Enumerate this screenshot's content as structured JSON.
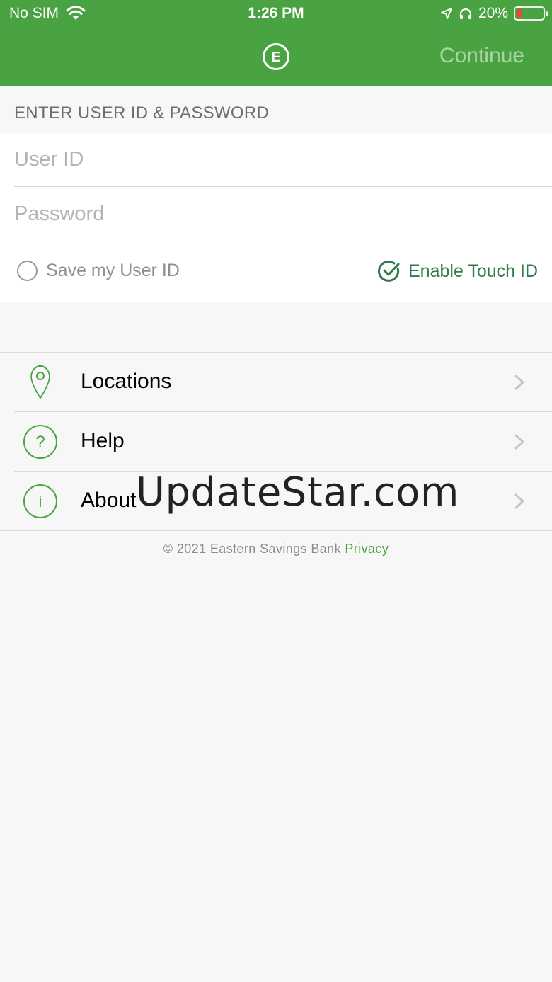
{
  "status_bar": {
    "carrier": "No SIM",
    "time": "1:26 PM",
    "battery_percent": "20%",
    "battery_level": 0.2,
    "icons": [
      "wifi-icon",
      "location-arrow-icon",
      "headphones-icon",
      "battery-icon"
    ]
  },
  "nav": {
    "logo_letter": "E",
    "continue_label": "Continue"
  },
  "login": {
    "section_title": "ENTER USER ID & PASSWORD",
    "user_id_placeholder": "User ID",
    "password_placeholder": "Password",
    "save_user_id_label": "Save my User ID",
    "save_user_id_checked": false,
    "touch_id_label": "Enable Touch ID",
    "touch_id_enabled": true
  },
  "menu": {
    "items": [
      {
        "label": "Locations",
        "icon": "location-pin-icon"
      },
      {
        "label": "Help",
        "icon": "question-circle-icon"
      },
      {
        "label": "About",
        "icon": "info-circle-icon"
      }
    ]
  },
  "footer": {
    "copyright": "© 2021 Eastern Savings Bank",
    "privacy_label": "Privacy"
  },
  "watermark": "UpdateStar.com",
  "colors": {
    "brand_green": "#4aa342",
    "touch_id_green": "#2f7a4a",
    "background": "#f8f7f8"
  }
}
